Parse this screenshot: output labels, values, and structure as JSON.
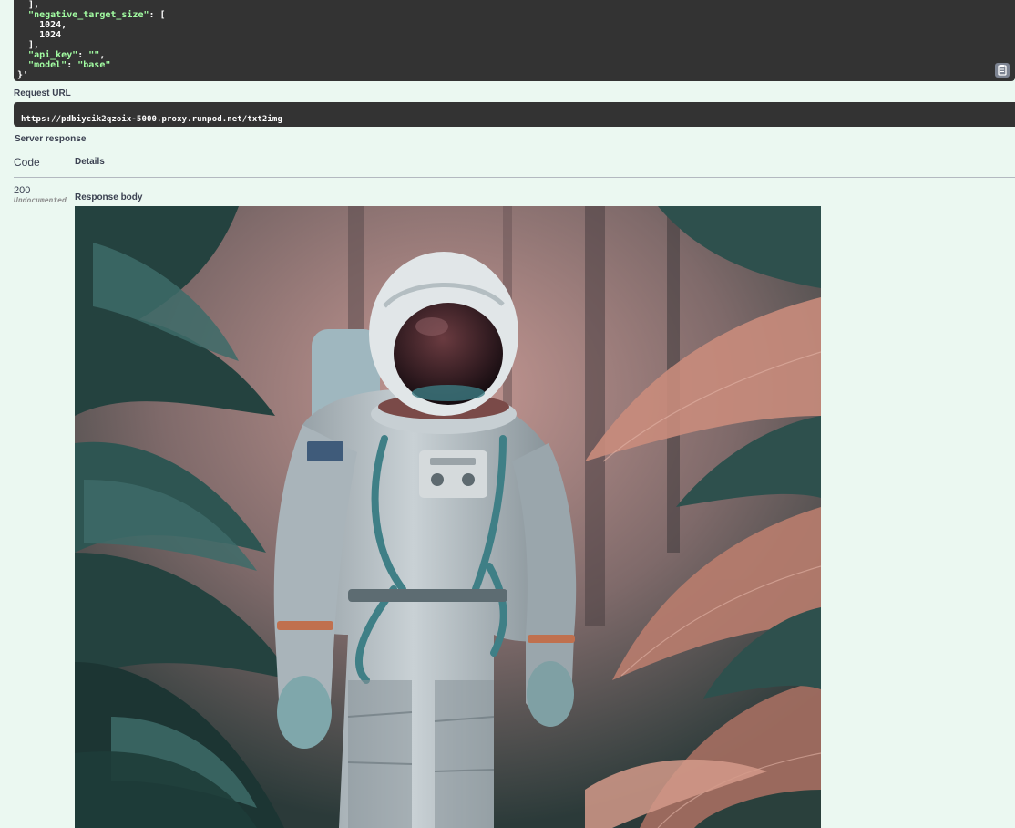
{
  "curl": {
    "lines": [
      {
        "text": "  ],",
        "kind": "plain"
      },
      {
        "key": "negative_target_size",
        "suffix": ": [",
        "kind": "key"
      },
      {
        "text": "    1024,",
        "kind": "num"
      },
      {
        "text": "    1024",
        "kind": "num"
      },
      {
        "text": "  ],",
        "kind": "plain"
      },
      {
        "key": "api_key",
        "value": "",
        "kind": "kv",
        "trail": ","
      },
      {
        "key": "model",
        "value": "base",
        "kind": "kv",
        "trail": ""
      },
      {
        "text": "}'",
        "kind": "plain"
      }
    ],
    "copy_icon": "clipboard-icon"
  },
  "request_url": {
    "label": "Request URL",
    "value": "https://pdbiycik2qzoix-5000.proxy.runpod.net/txt2img"
  },
  "server_response": {
    "label": "Server response",
    "col_code": "Code",
    "col_details": "Details",
    "status_code": "200",
    "status_note": "Undocumented",
    "body_label": "Response body"
  },
  "image": {
    "subject": "astronaut-in-jungle",
    "colors": {
      "foliage_dark": "#24423f",
      "foliage_teal": "#3d6b68",
      "foliage_pink": "#c98c7c",
      "mist": "#b58a86",
      "suit": "#b9c3c8",
      "visor": "#3a1f24"
    }
  },
  "colors": {
    "page_bg": "#ebf8f1",
    "code_bg": "#333333",
    "code_string": "#a2fca2"
  }
}
